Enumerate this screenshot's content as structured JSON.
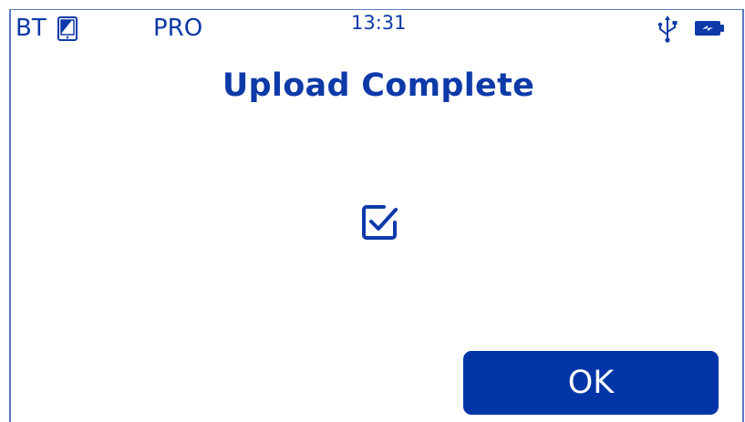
{
  "status_bar": {
    "bt_label": "BT",
    "mode_label": "PRO",
    "time": "13:31",
    "icons": {
      "device": "tablet-icon",
      "usb": "usb-icon",
      "battery": "battery-charging-icon"
    }
  },
  "dialog": {
    "title": "Upload Complete",
    "status_icon": "checkbox-checked-icon",
    "ok_label": "OK"
  },
  "colors": {
    "accent": "#0d3aa8",
    "button": "#0035a8",
    "frame": "#5a79c0"
  }
}
